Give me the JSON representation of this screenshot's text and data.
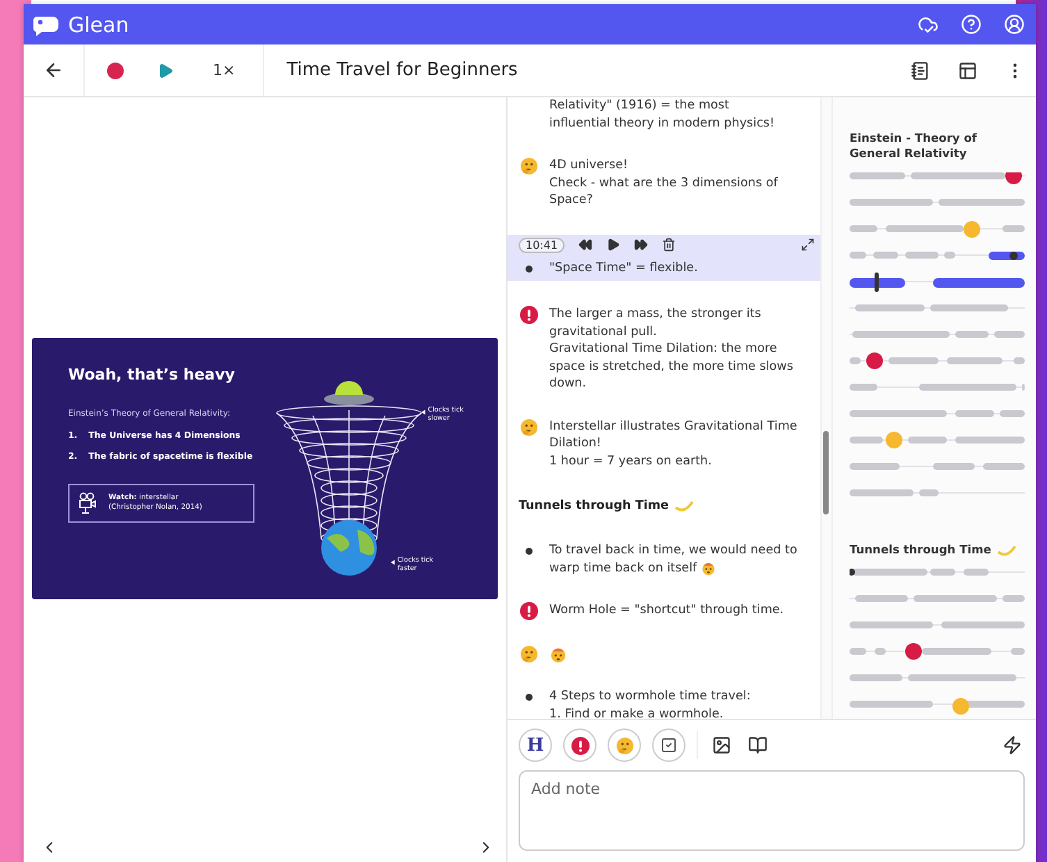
{
  "app": {
    "name": "Glean"
  },
  "toolbar": {
    "speed": "1×",
    "title": "Time Travel for Beginners"
  },
  "slide": {
    "title": "Woah, that’s heavy",
    "subtitle": "Einstein’s Theory of General Relativity:",
    "points": [
      {
        "number": "1.",
        "text": "The Universe has 4 Dimensions"
      },
      {
        "number": "2.",
        "text": "The fabric of spacetime is flexible"
      }
    ],
    "watch": [
      "**Watch:** interstellar",
      "(Christopher Nolan, 2014)"
    ],
    "labels": [
      "Clocks tick slower",
      "Clocks tick faster"
    ]
  },
  "notes": [
    {
      "kind": "plain",
      "selected": false,
      "lines": [
        "Relativity\" (1916) = the most",
        "influential theory in modern physics!"
      ]
    },
    {
      "kind": "question",
      "selected": false,
      "lines": [
        "4D universe!",
        "Check - what are the 3 dimensions of Space?"
      ]
    },
    {
      "kind": "bullet",
      "selected": true,
      "time": "10:41",
      "lines": [
        "\"Space Time\" = flexible."
      ]
    },
    {
      "kind": "important",
      "selected": false,
      "lines": [
        "The larger a mass, the stronger its gravitational pull.",
        "Gravitational Time Dilation: the more space is stretched, the more time slows down."
      ]
    },
    {
      "kind": "question",
      "selected": false,
      "lines": [
        "Interstellar illustrates Gravitational Time Dilation!",
        "1 hour = 7 years on earth."
      ]
    },
    {
      "kind": "heading",
      "selected": false,
      "lines": [
        "Tunnels through Time"
      ]
    },
    {
      "kind": "bullet",
      "selected": false,
      "reaction": true,
      "lines": [
        "To travel back in time, we would need to warp time back on itself"
      ]
    },
    {
      "kind": "important",
      "selected": false,
      "lines": [
        "Worm Hole = \"shortcut\" through time."
      ]
    },
    {
      "kind": "reactions",
      "selected": false
    },
    {
      "kind": "bullet",
      "selected": false,
      "lines": [
        "4 Steps to wormhole time travel:",
        "1. Find or make a wormhole."
      ]
    }
  ],
  "outline": [
    {
      "title": "Einstein - Theory of General Relativity"
    },
    {
      "title": "Tunnels through Time"
    }
  ],
  "composer": {
    "heading_button": "H",
    "placeholder": "Add note"
  }
}
